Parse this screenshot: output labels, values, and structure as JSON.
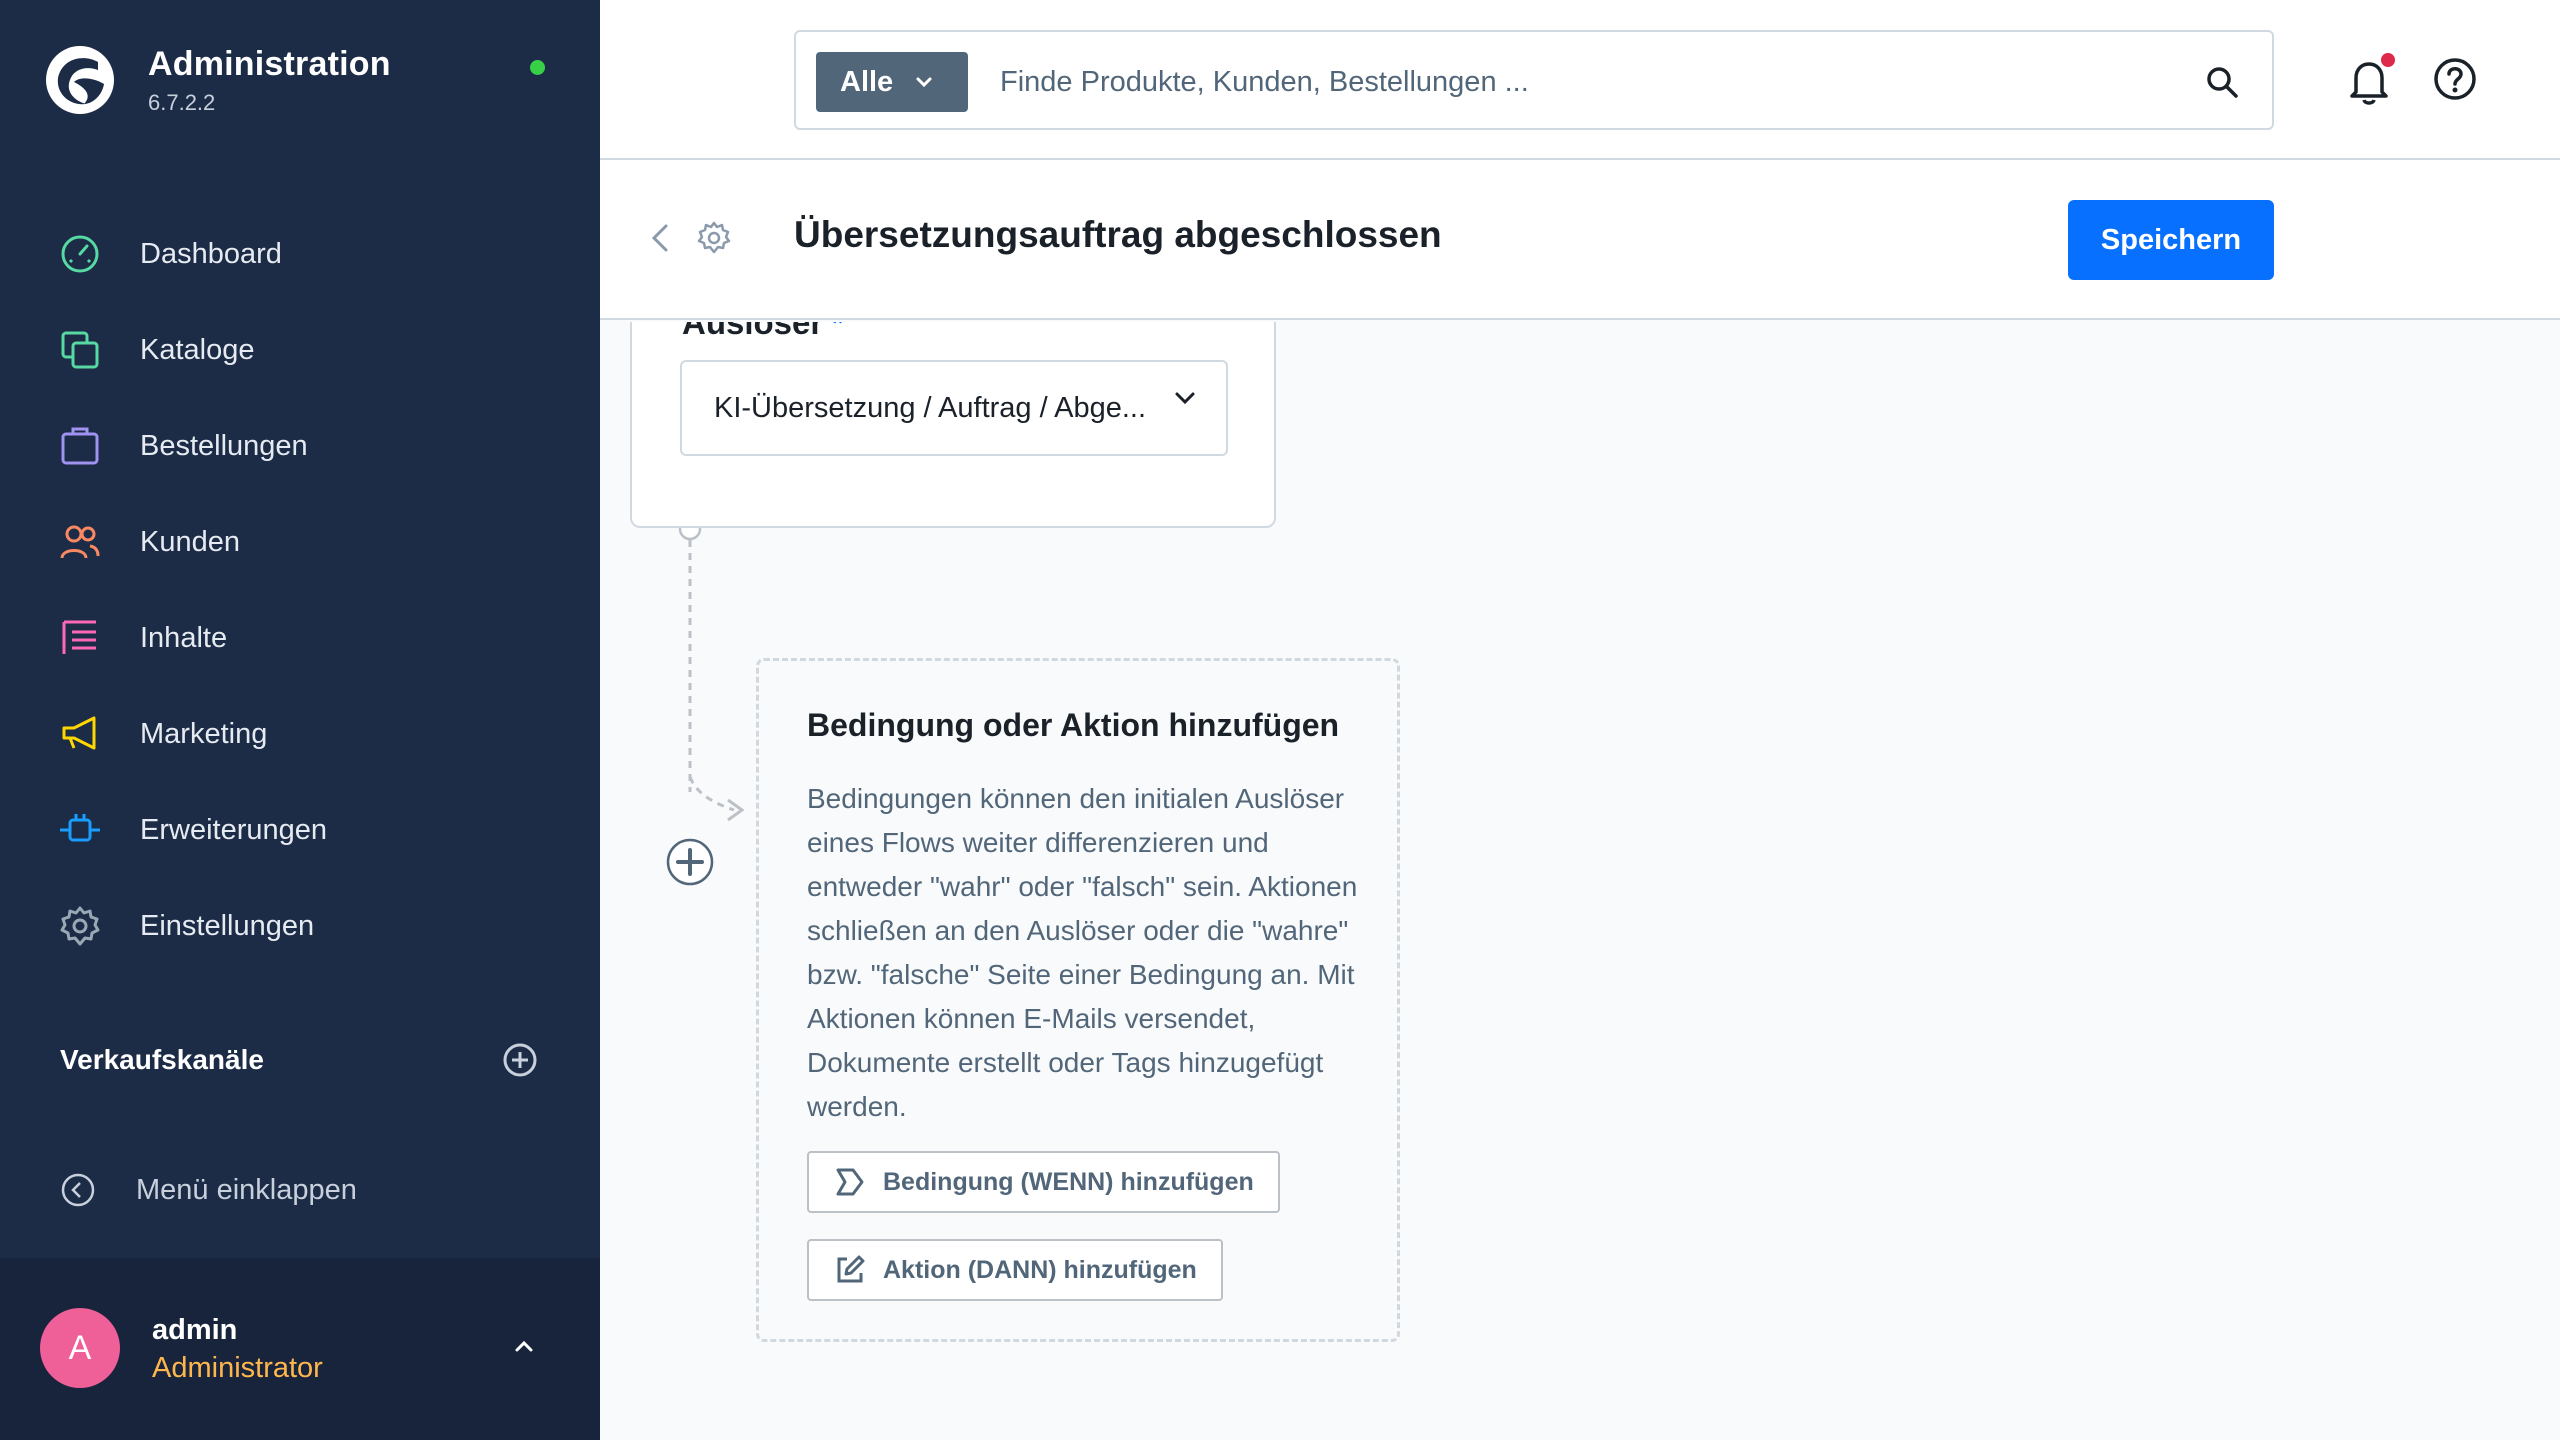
{
  "brand": {
    "title": "Administration",
    "version": "6.7.2.2"
  },
  "sidebar": {
    "items": [
      {
        "label": "Dashboard",
        "icon": "dashboard-icon",
        "color": "#57d9a3"
      },
      {
        "label": "Kataloge",
        "icon": "catalog-icon",
        "color": "#57d9a3"
      },
      {
        "label": "Bestellungen",
        "icon": "orders-icon",
        "color": "#a092f0"
      },
      {
        "label": "Kunden",
        "icon": "customers-icon",
        "color": "#f88962"
      },
      {
        "label": "Inhalte",
        "icon": "content-icon",
        "color": "#ff68b4"
      },
      {
        "label": "Marketing",
        "icon": "marketing-icon",
        "color": "#ffd700"
      },
      {
        "label": "Erweiterungen",
        "icon": "extensions-icon",
        "color": "#189eff"
      },
      {
        "label": "Einstellungen",
        "icon": "settings-icon",
        "color": "#9aa8b5"
      }
    ],
    "channels_title": "Verkaufskanäle",
    "collapse_label": "Menü einklappen"
  },
  "user": {
    "initial": "A",
    "name": "admin",
    "role": "Administrator"
  },
  "search": {
    "scope": "Alle",
    "placeholder": "Finde Produkte, Kunden, Bestellungen ..."
  },
  "header": {
    "title": "Übersetzungsauftrag abgeschlossen",
    "save_label": "Speichern"
  },
  "trigger": {
    "label": "Auslöser",
    "required_mark": "*",
    "value": "KI-Übersetzung / Auftrag / Abge..."
  },
  "add_panel": {
    "title": "Bedingung oder Aktion hinzufügen",
    "description": "Bedingungen können den initialen Auslöser eines Flows weiter differenzieren und entweder \"wahr\" oder \"falsch\" sein. Aktionen schließen an den Auslöser oder die \"wahre\" bzw. \"falsche\" Seite einer Bedingung an. Mit Aktionen können E-Mails versendet, Dokumente erstellt oder Tags hinzugefügt werden.",
    "condition_button": "Bedingung (WENN) hinzufügen",
    "action_button": "Aktion (DANN) hinzufügen"
  },
  "colors": {
    "accent": "#0870ff",
    "sidebar": "#1c2b46",
    "status_online": "#37d046",
    "notification": "#de294c"
  }
}
